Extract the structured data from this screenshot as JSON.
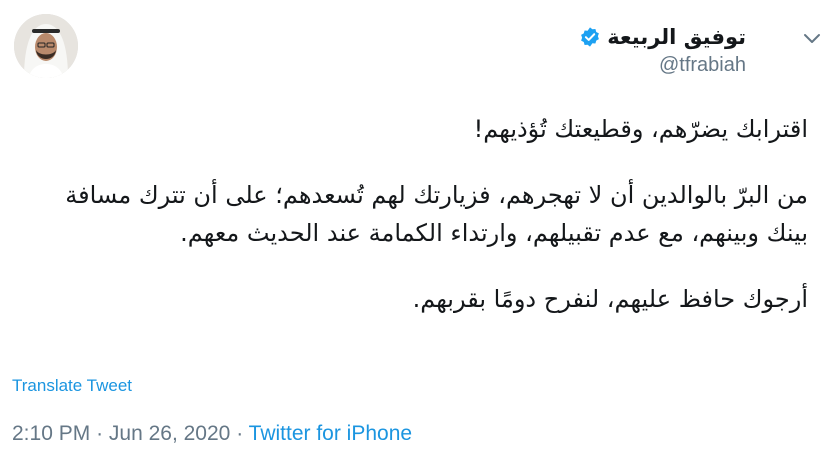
{
  "author": {
    "display_name": "توفيق الربيعة",
    "handle": "@tfrabiah"
  },
  "tweet": {
    "paragraphs": [
      [
        "اقترابك يضرّهم، وقطيعتك تُؤذيهم!"
      ],
      [
        "من البرّ بالوالدين أن لا تهجرهم، فزيارتك لهم تُسعدهم؛ على أن تترك مسافة",
        "بينك وبينهم، مع عدم تقبيلهم، وارتداء الكمامة عند الحديث معهم."
      ],
      [
        "أرجوك حافظ عليهم، لنفرح دومًا بقربهم."
      ]
    ],
    "translate_label": "Translate Tweet",
    "time": "2:10 PM",
    "date": "Jun 26, 2020",
    "separator": "·",
    "source": "Twitter for iPhone"
  },
  "colors": {
    "link": "#1b95e0",
    "muted": "#657786",
    "text": "#14171a",
    "verified": "#1da1f2"
  },
  "icons": {
    "menu": "chevron-down-icon",
    "verified": "verified-badge-icon"
  }
}
